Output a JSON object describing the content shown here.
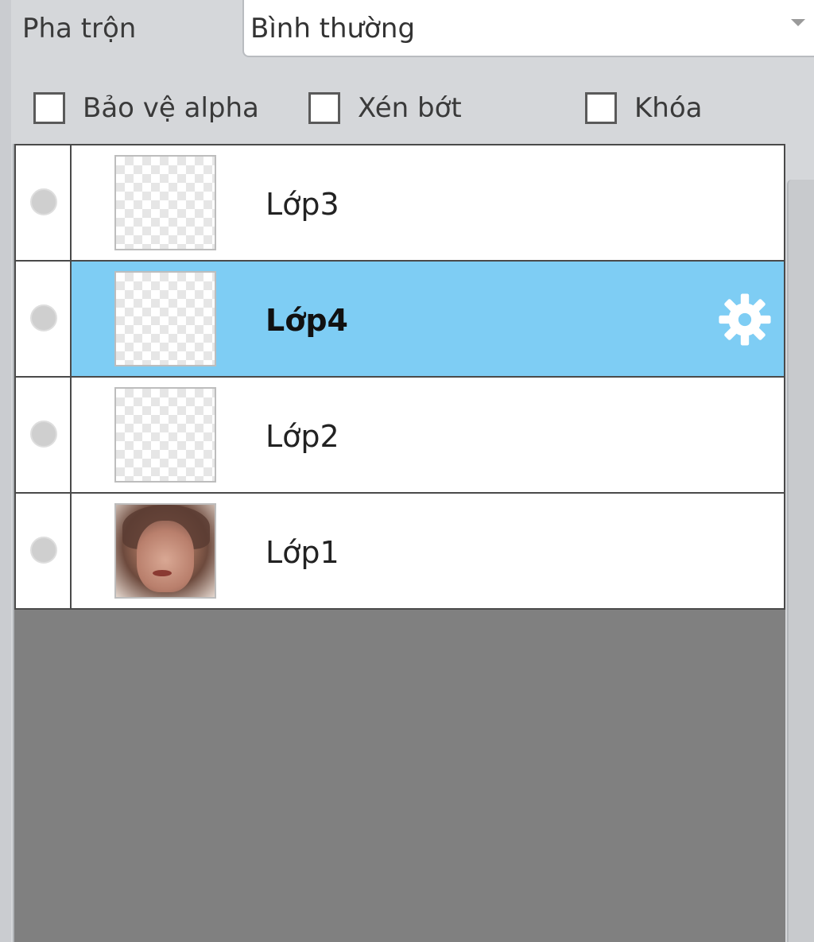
{
  "blend": {
    "label": "Pha trộn",
    "value": "Bình thường"
  },
  "options": {
    "protect_alpha": {
      "label": "Bảo vệ alpha",
      "checked": false
    },
    "clip": {
      "label": "Xén bớt",
      "checked": false
    },
    "lock": {
      "label": "Khóa",
      "checked": false
    }
  },
  "layers": [
    {
      "name": "Lớp3",
      "selected": false,
      "thumbnail": "transparent"
    },
    {
      "name": "Lớp4",
      "selected": true,
      "thumbnail": "transparent"
    },
    {
      "name": "Lớp2",
      "selected": false,
      "thumbnail": "transparent"
    },
    {
      "name": "Lớp1",
      "selected": false,
      "thumbnail": "photo"
    }
  ],
  "colors": {
    "selected_row": "#7ecdf4",
    "panel_bg": "#d5d7da",
    "list_bg": "#808080"
  },
  "icons": {
    "layer_settings": "gear-icon",
    "visibility": "visibility-dot-icon",
    "dropdown": "chevron-down-icon"
  }
}
